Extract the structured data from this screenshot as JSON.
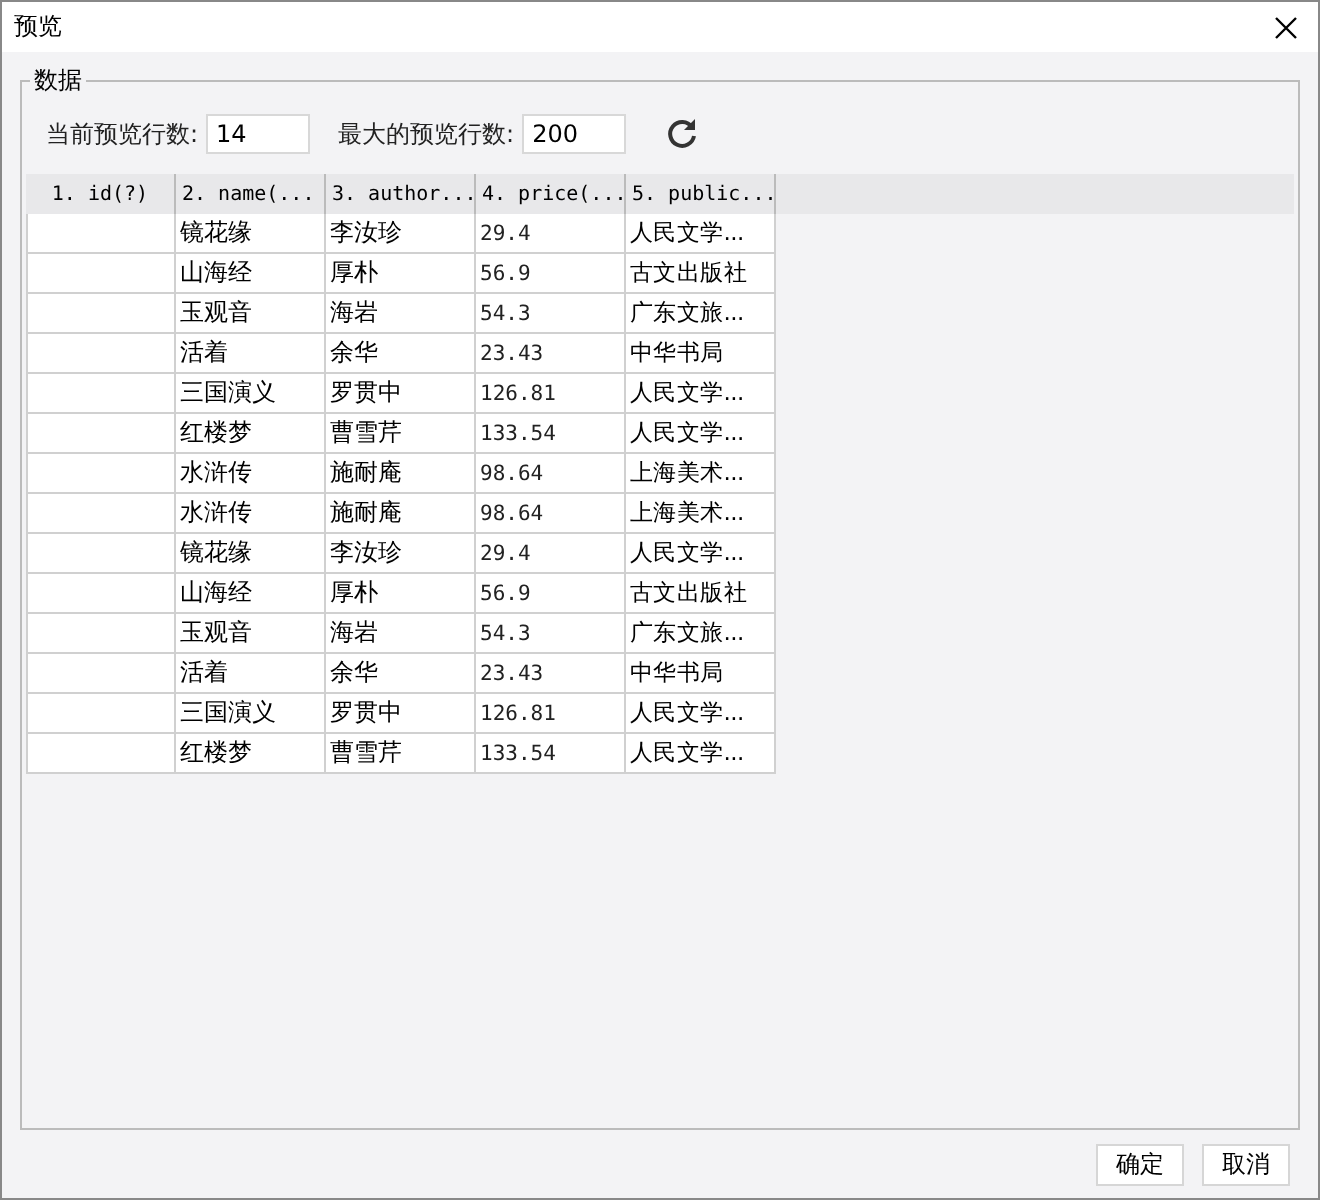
{
  "window": {
    "title": "预览"
  },
  "group": {
    "title": "数据"
  },
  "settings": [
    {
      "label": "当前预览行数:",
      "value": "14"
    },
    {
      "label": "最大的预览行数:",
      "value": "200"
    }
  ],
  "table": {
    "columns": [
      "1. id(?)",
      "2. name(...",
      "3. author...",
      "4. price(...",
      "5. public..."
    ],
    "rows": [
      [
        "",
        "镜花缘",
        "李汝珍",
        "29.4",
        "人民文学..."
      ],
      [
        "",
        "山海经",
        "厚朴",
        "56.9",
        "古文出版社"
      ],
      [
        "",
        "玉观音",
        "海岩",
        "54.3",
        "广东文旅..."
      ],
      [
        "",
        "活着",
        "余华",
        "23.43",
        "中华书局"
      ],
      [
        "",
        "三国演义",
        "罗贯中",
        "126.81",
        "人民文学..."
      ],
      [
        "",
        "红楼梦",
        "曹雪芹",
        "133.54",
        "人民文学..."
      ],
      [
        "",
        "水浒传",
        "施耐庵",
        "98.64",
        "上海美术..."
      ],
      [
        "",
        "水浒传",
        "施耐庵",
        "98.64",
        "上海美术..."
      ],
      [
        "",
        "镜花缘",
        "李汝珍",
        "29.4",
        "人民文学..."
      ],
      [
        "",
        "山海经",
        "厚朴",
        "56.9",
        "古文出版社"
      ],
      [
        "",
        "玉观音",
        "海岩",
        "54.3",
        "广东文旅..."
      ],
      [
        "",
        "活着",
        "余华",
        "23.43",
        "中华书局"
      ],
      [
        "",
        "三国演义",
        "罗贯中",
        "126.81",
        "人民文学..."
      ],
      [
        "",
        "红楼梦",
        "曹雪芹",
        "133.54",
        "人民文学..."
      ]
    ]
  },
  "buttons": [
    "确定",
    "取消"
  ]
}
